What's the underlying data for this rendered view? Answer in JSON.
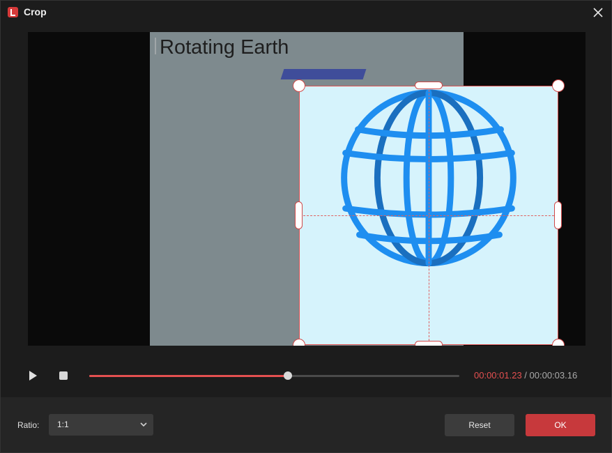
{
  "window": {
    "title": "Crop",
    "app_icon": "app-logo-icon",
    "close_icon": "close-icon"
  },
  "preview": {
    "frame_text": "Rotating Earth",
    "frame_background": "#7e8a8e",
    "crop_area_background": "#d6f3fc",
    "globe_color": "#1e8ef0",
    "crop_border_color": "#e05050"
  },
  "playback": {
    "play_icon": "play-icon",
    "stop_icon": "stop-icon",
    "current_time": "00:00:01.23",
    "separator": " / ",
    "total_time": "00:00:03.16",
    "progress_fraction": 0.537
  },
  "footer": {
    "ratio_label": "Ratio:",
    "ratio_value": "1:1",
    "reset_label": "Reset",
    "ok_label": "OK",
    "accent_color": "#c7393c"
  }
}
